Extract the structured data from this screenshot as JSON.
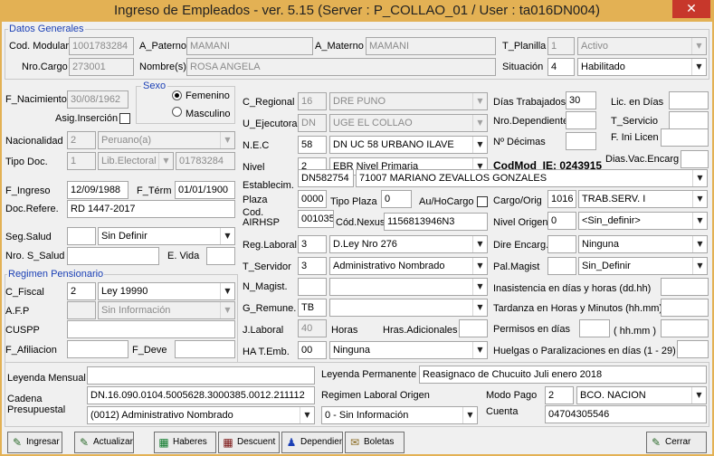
{
  "window": {
    "title": "Ingreso de Empleados - ver. 5.15 (Server : P_COLLAO_01 / User : ta016DN004)",
    "close_glyph": "✕"
  },
  "datos_generales": {
    "legend": "Datos Generales",
    "cod_modular_label": "Cod. Modular",
    "cod_modular": "1001783284",
    "a_paterno_label": "A_Paterno",
    "a_paterno": "MAMANI",
    "a_materno_label": "A_Materno",
    "a_materno": "MAMANI",
    "t_planilla_label": "T_Planilla",
    "t_planilla_code": "1",
    "t_planilla_value": "Activo",
    "nro_cargo_label": "Nro.Cargo",
    "nro_cargo": "273001",
    "nombres_label": "Nombre(s)",
    "nombres": "ROSA ANGELA",
    "situacion_label": "Situación",
    "situacion_code": "4",
    "situacion_value": "Habilitado"
  },
  "personal": {
    "f_nacimiento_label": "F_Nacimiento",
    "f_nacimiento": "30/08/1962",
    "sexo_legend": "Sexo",
    "femenino": "Femenino",
    "masculino": "Masculino",
    "asig_insercion_label": "Asig.Inserción",
    "nacionalidad_label": "Nacionalidad",
    "nacionalidad_code": "2",
    "nacionalidad_value": "Peruano(a)",
    "tipo_doc_label": "Tipo Doc.",
    "tipo_doc_code": "1",
    "tipo_doc_value": "Lib.Electoral",
    "doc_number": "01783284",
    "f_ingreso_label": "F_Ingreso",
    "f_ingreso": "12/09/1988",
    "f_term_label": "F_Térm",
    "f_term": "01/01/1900",
    "doc_refere_label": "Doc.Refere.",
    "doc_refere": "RD 1447-2017",
    "seg_salud_label": "Seg.Salud",
    "seg_salud_value": "Sin Definir",
    "nro_s_salud_label": "Nro. S_Salud",
    "e_vida_label": "E. Vida"
  },
  "regimen": {
    "legend": "Regimen Pensionario",
    "c_fiscal_label": "C_Fiscal",
    "c_fiscal_code": "2",
    "c_fiscal_value": "Ley 19990",
    "afp_label": "A.F.P",
    "afp_value": "Sin Información",
    "cuspp_label": "CUSPP",
    "f_afiliacion_label": "F_Afiliacion",
    "f_deve_label": "F_Deve"
  },
  "laboral": {
    "c_regional_label": "C_Regional",
    "c_regional_code": "16",
    "c_regional_value": "DRE PUNO",
    "u_ejecutora_label": "U_Ejecutora",
    "u_ejecutora_code": "DN",
    "u_ejecutora_value": "UGE EL COLLAO",
    "nec_label": "N.E.C",
    "nec_code": "58",
    "nec_value": "DN UC 58  URBANO ILAVE",
    "nivel_label": "Nivel",
    "nivel_code": "2",
    "nivel_value": "EBR Nivel Primaria",
    "codmod_ie": "CodMod_IE: 0243915",
    "establecim_label": "Establecim.",
    "establecim_code": "DN582754",
    "establecim_value": "71007 MARIANO ZEVALLOS GONZALES",
    "plaza_label": "Plaza",
    "plaza": "0000",
    "tipo_plaza_label": "Tipo Plaza",
    "tipo_plaza": "0",
    "au_hocargo_label": "Au/HoCargo",
    "cargo_orig_label": "Cargo/Orig",
    "cargo_orig_code": "1016",
    "cargo_orig_value": "TRAB.SERV.   I",
    "cod_airhsp_label": "Cod. AIRHSP",
    "cod_airhsp": "001035",
    "cod_nexus_label": "Cód.Nexus",
    "cod_nexus": "1156813946N3",
    "nivel_origen_label": "Nivel Origen",
    "nivel_origen_code": "0",
    "nivel_origen_value": "<Sin_definir>",
    "reg_laboral_label": "Reg.Laboral",
    "reg_laboral_code": "3",
    "reg_laboral_value": "D.Ley Nro 276",
    "dire_encarg_label": "Dire Encarg.",
    "dire_encarg_value": "Ninguna",
    "t_servidor_label": "T_Servidor",
    "t_servidor_code": "3",
    "t_servidor_value": "Administrativo Nombrado",
    "pal_magist_label": "Pal.Magist",
    "pal_magist_value": "Sin_Definir",
    "n_magist_label": "N_Magist.",
    "g_remune_label": "G_Remune.",
    "g_remune_code": "TB",
    "j_laboral_label": "J.Laboral",
    "j_laboral": "40",
    "horas_label": "Horas",
    "horas_adicionales_label": "Hras.Adicionales",
    "ha_temb_label": "HA T.Emb.",
    "ha_temb_code": "00",
    "ha_temb_value": "Ninguna"
  },
  "right_col": {
    "dias_trabajados_label": "Días Trabajados",
    "dias_trabajados": "30",
    "lic_en_dias_label": "Lic. en Días",
    "nro_dependiente_label": "Nro.Dependiente",
    "t_servicio_label": "T_Servicio",
    "nro_decimas_label": "Nº Décimas",
    "f_ini_licen_label": "F. Ini Licen",
    "dias_vac_encarg_label": "Dias.Vac.Encarg",
    "inasistencia_label": "Inasistencia en días y horas (dd.hh)",
    "tardanza_label": "Tardanza en Horas y Minutos (hh.mm)",
    "permisos_label": "Permisos en días",
    "hhmm_label": "( hh.mm )",
    "huelgas_label": "Huelgas o Paralizaciones en días (1 - 29)"
  },
  "bottom": {
    "leyenda_mensual_label": "Leyenda Mensual",
    "leyenda_permanente_label": "Leyenda Permanente",
    "leyenda_permanente": "Reasignaco de Chucuito Juli enero 2018",
    "cadena_label_1": "Cadena",
    "cadena_label_2": "Presupuestal",
    "cadena": "DN.16.090.0104.5005628.3000385.0012.211112",
    "regimen_laboral_origen_label": "Regimen Laboral Origen",
    "modo_pago_label": "Modo Pago",
    "modo_pago_code": "2",
    "modo_pago_value": "BCO. NACION",
    "cadena_select": "(0012) Administrativo Nombrado",
    "regimen_origen_value": "0 - Sin Información",
    "cuenta_label": "Cuenta",
    "cuenta": "04704305546"
  },
  "buttons": {
    "ingresar": "Ingresar",
    "actualizar": "Actualizar",
    "haberes": "Haberes",
    "descuent": "Descuent",
    "dependient": "Dependient",
    "boletas": "Boletas",
    "cerrar": "Cerrar"
  },
  "icons": {
    "dropdown": "▼",
    "ingresar": "✎",
    "actualizar": "✎",
    "haberes": "▦",
    "descuent": "▦",
    "dependient": "♟",
    "boletas": "✉",
    "cerrar": "✎"
  },
  "colors": {
    "titlebar": "#e3b154",
    "legend": "#1a3fb5",
    "close": "#c7372b"
  }
}
